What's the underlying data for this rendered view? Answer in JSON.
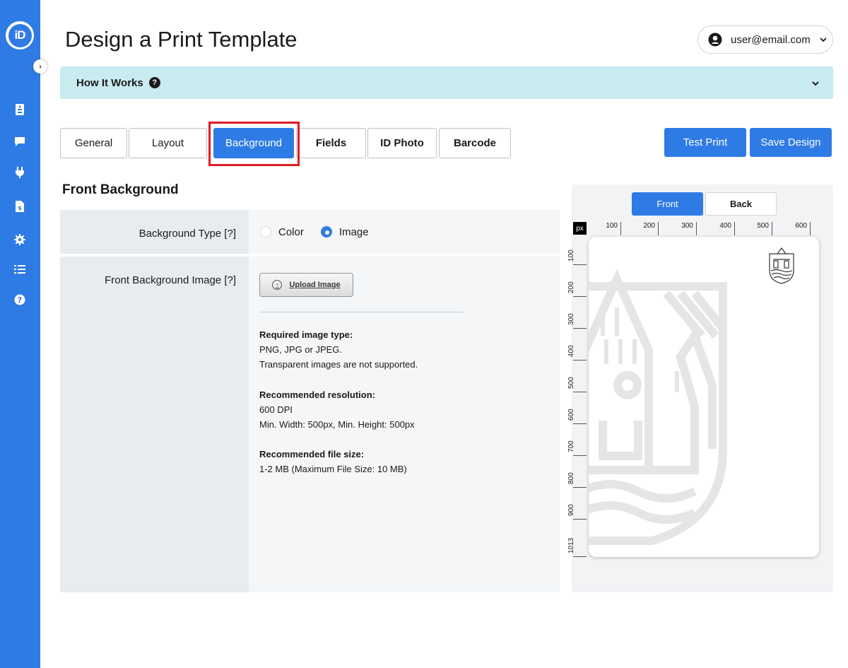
{
  "app": {
    "logo_text": "iD"
  },
  "sidebar": {
    "items": [
      {
        "icon": "id-badge-icon"
      },
      {
        "icon": "chat-icon"
      },
      {
        "icon": "plug-icon"
      },
      {
        "icon": "invoice-icon"
      },
      {
        "icon": "gear-icon"
      },
      {
        "icon": "list-icon"
      },
      {
        "icon": "help-icon"
      }
    ]
  },
  "header": {
    "title": "Design a Print Template",
    "user_email": "user@email.com"
  },
  "how_it_works": {
    "label": "How It Works"
  },
  "tabs": [
    {
      "label": "General"
    },
    {
      "label": "Layout"
    },
    {
      "label": "Background",
      "active": true
    },
    {
      "label": "Fields"
    },
    {
      "label": "ID Photo"
    },
    {
      "label": "Barcode"
    }
  ],
  "actions": {
    "test_print": "Test Print",
    "save_design": "Save Design"
  },
  "section": {
    "title": "Front Background",
    "background_type_label": "Background Type [?]",
    "options": {
      "color": "Color",
      "image": "Image"
    },
    "selected_option": "Image",
    "image_label": "Front Background Image [?]",
    "upload_label": "Upload Image",
    "info": {
      "type_heading": "Required image type:",
      "type_line1": "PNG, JPG or JPEG.",
      "type_line2": "Transparent images are not supported.",
      "res_heading": "Recommended resolution:",
      "res_line1": "600 DPI",
      "res_line2": "Min. Width: 500px, Min. Height: 500px",
      "size_heading": "Recommended file size:",
      "size_line1": "1-2 MB (Maximum File Size: 10 MB)"
    }
  },
  "preview": {
    "front_label": "Front",
    "back_label": "Back",
    "unit": "px",
    "h_ticks": [
      "100",
      "200",
      "300",
      "400",
      "500",
      "600"
    ],
    "v_ticks": [
      "100",
      "200",
      "300",
      "400",
      "500",
      "600",
      "700",
      "800",
      "900",
      "1013"
    ]
  },
  "colors": {
    "accent": "#2f7be5",
    "info_bar": "#c8ebf0",
    "highlight": "#e01b24"
  }
}
